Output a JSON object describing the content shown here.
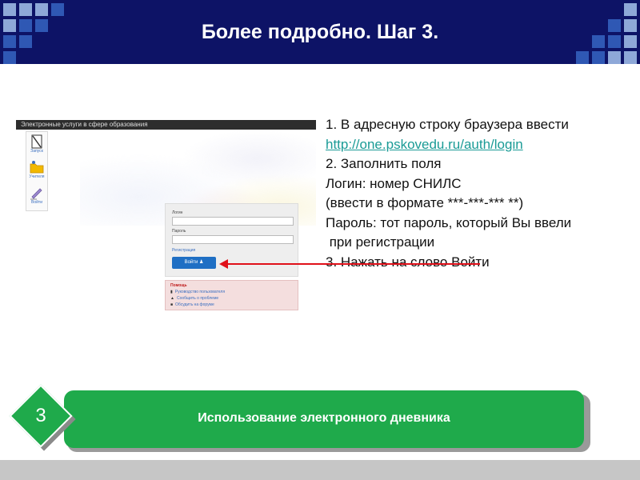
{
  "header": {
    "title": "Более подробно. Шаг 3.",
    "background_color": "#0d1366",
    "accent_light": "#8ea8d8",
    "accent_mid": "#2f58b4"
  },
  "screenshot": {
    "bar_title": "Электронные услуги в сфере образования",
    "sidebar": [
      {
        "label": "Запуск",
        "icon": "document-icon"
      },
      {
        "label": "Учителя",
        "icon": "folder-icon"
      },
      {
        "label": "Войти",
        "icon": "pen-icon"
      }
    ],
    "login_form": {
      "login_label": "Логин",
      "password_label": "Пароль",
      "register_link": "Регистрация",
      "login_button": "Войти ♟"
    },
    "help": {
      "title": "Помощь",
      "items": [
        "Руководство пользователя",
        "Сообщить о проблеме",
        "Обсудить на форуме"
      ]
    }
  },
  "instructions": {
    "line1": "1. В адресную строку браузера ввести",
    "link": "http://one.pskovedu.ru/auth/login",
    "line2": "2. Заполнить поля",
    "line3": "Логин: номер СНИЛС",
    "line4": "(ввести в формате ***-***-***  **)",
    "line5": "Пароль: тот пароль, который Вы ввели",
    "line6": " при регистрации",
    "line7": "3. Нажать на слово Войти"
  },
  "banner": {
    "step_number": "3",
    "text": "Использование электронного дневника",
    "color": "#1faa4b"
  },
  "arrow_color": "#e0101a"
}
